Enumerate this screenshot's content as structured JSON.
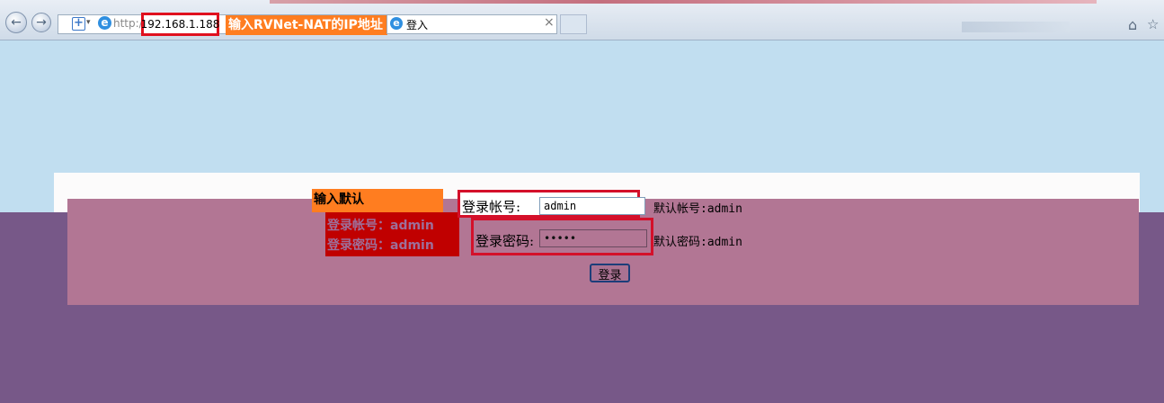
{
  "browser": {
    "address_prefix": "http:/",
    "address_host": "192.168.1.188",
    "callout_ip": "输入RVNet-NAT的IP地址",
    "tab_title": "登入",
    "tab_close": "×",
    "icons": {
      "back": "back-arrow-icon",
      "forward": "forward-arrow-icon",
      "home": "home-icon",
      "favorites": "star-icon"
    }
  },
  "annotation": {
    "title": "输入默认",
    "line1": "登录帐号：admin",
    "line2": "登录密码：admin"
  },
  "login_form": {
    "username_label": "登录帐号:",
    "username_value": "admin",
    "username_hint": "默认帐号:admin",
    "password_label": "登录密码:",
    "password_value": "•••••",
    "password_hint": "默认密码:admin",
    "submit_label": "登录"
  },
  "colors": {
    "page_background": "#c1def0",
    "callout_orange": "#ff7d20",
    "highlight_red": "#d4102a",
    "overlay_purple": "#775888",
    "form_pink": "#b27694"
  }
}
